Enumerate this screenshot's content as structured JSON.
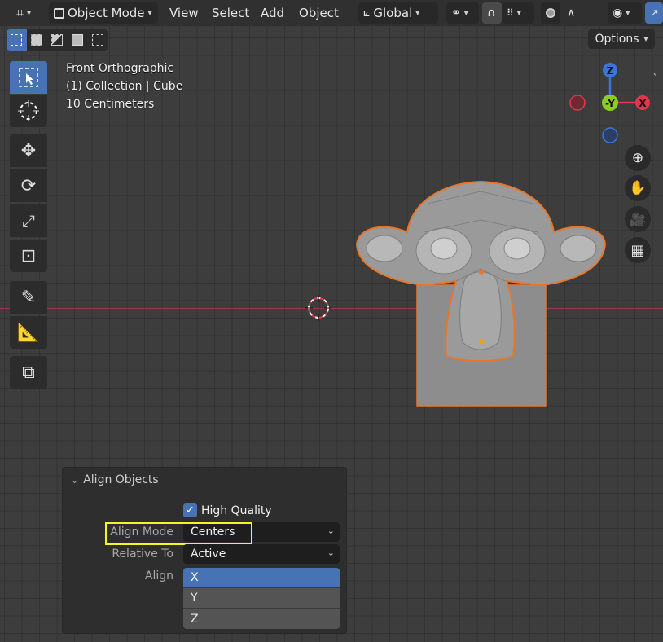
{
  "header": {
    "mode_label": "Object Mode",
    "menu": [
      "View",
      "Select",
      "Add",
      "Object"
    ],
    "orientation_label": "Global"
  },
  "options_label": "Options",
  "viewport_info": {
    "view_name": "Front Orthographic",
    "collection": "(1) Collection",
    "object": "Cube",
    "scale": "10 Centimeters"
  },
  "gizmo": {
    "z": "Z",
    "y": "-Y",
    "x": "X"
  },
  "panel": {
    "title": "Align Objects",
    "high_quality_label": "High Quality",
    "high_quality_checked": true,
    "align_mode_label": "Align Mode",
    "align_mode_value": "Centers",
    "relative_to_label": "Relative To",
    "relative_to_value": "Active",
    "align_label": "Align",
    "axes": [
      "X",
      "Y",
      "Z"
    ],
    "selected_axis": "X"
  },
  "colors": {
    "accent": "#4772b3",
    "selection_outline": "#e7762b",
    "highlight_box": "#f7f425",
    "x_axis": "#e2364a",
    "y_axis": "#8bcc25",
    "z_axis": "#3b76d6"
  }
}
